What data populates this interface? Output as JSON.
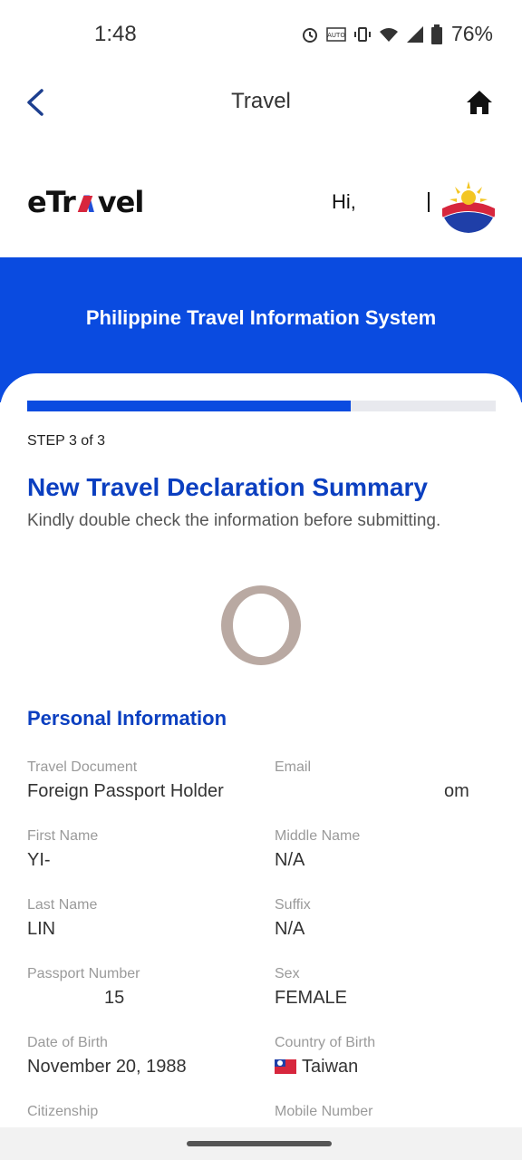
{
  "status_bar": {
    "time": "1:48",
    "battery": "76%",
    "icons": [
      "alarm-icon",
      "auto-rotate-icon",
      "vibrate-icon",
      "wifi-icon",
      "signal-icon",
      "battery-icon"
    ]
  },
  "app_bar": {
    "title": "Travel",
    "back_icon": "chevron-left-icon",
    "home_icon": "home-icon"
  },
  "brand": {
    "logo_text_1": "eTr",
    "logo_text_2": "vel",
    "greeting": "Hi,"
  },
  "banner": {
    "title": "Philippine Travel Information System"
  },
  "progress": {
    "fraction": 0.69,
    "step_label": "STEP 3 of 3"
  },
  "summary": {
    "title": "New Travel Declaration Summary",
    "subtitle": "Kindly double check the information before submitting."
  },
  "personal": {
    "section_title": "Personal Information",
    "fields": [
      {
        "label": "Travel Document",
        "value": "Foreign Passport Holder"
      },
      {
        "label": "Email",
        "value": "om"
      },
      {
        "label": "First Name",
        "value": "YI-"
      },
      {
        "label": "Middle Name",
        "value": "N/A"
      },
      {
        "label": "Last Name",
        "value": "LIN"
      },
      {
        "label": "Suffix",
        "value": "N/A"
      },
      {
        "label": "Passport Number",
        "value": "15"
      },
      {
        "label": "Sex",
        "value": "FEMALE"
      },
      {
        "label": "Date of Birth",
        "value": "November 20, 1988"
      },
      {
        "label": "Country of Birth",
        "value": "Taiwan"
      },
      {
        "label": "Citizenship",
        "value": ""
      },
      {
        "label": "Mobile Number",
        "value": ""
      }
    ]
  },
  "colors": {
    "accent": "#0a4be0",
    "heading": "#0b3fc0"
  }
}
